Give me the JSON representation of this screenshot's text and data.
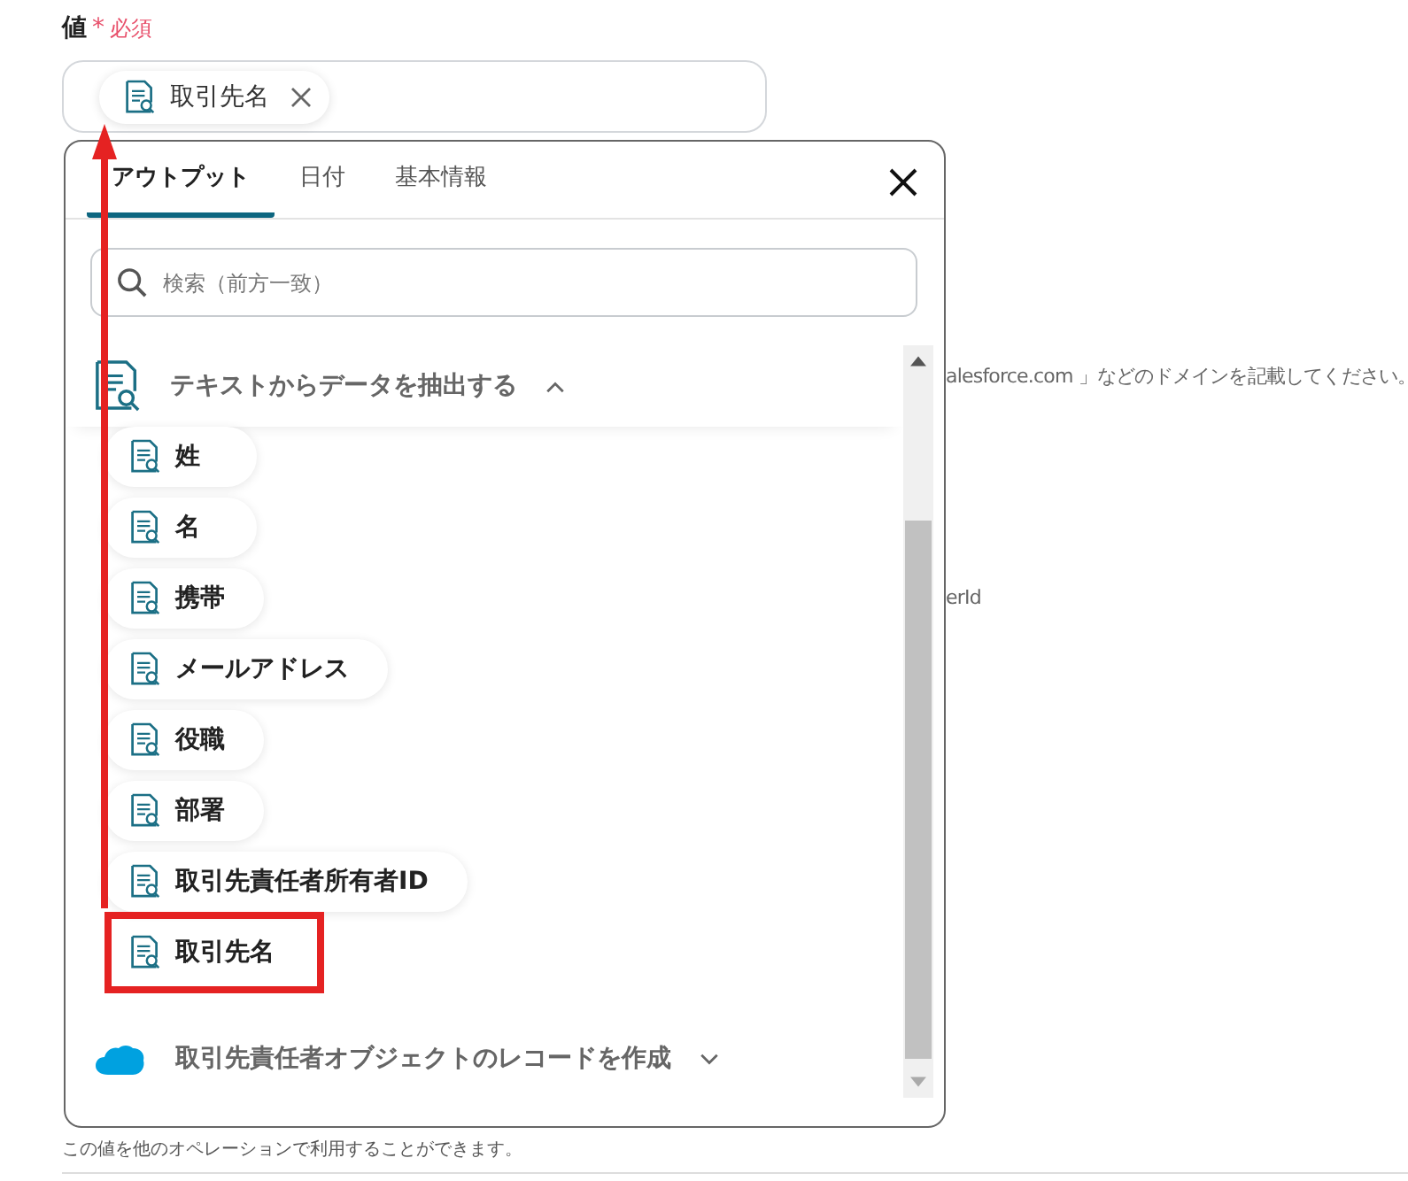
{
  "field": {
    "label": "値",
    "required_mark": "*",
    "required_text": "必須",
    "chips": [
      {
        "label": "取引先名"
      }
    ]
  },
  "popup": {
    "tabs": [
      {
        "label": "アウトプット",
        "selected": true
      },
      {
        "label": "日付",
        "selected": false
      },
      {
        "label": "基本情報",
        "selected": false
      }
    ],
    "search": {
      "placeholder": "検索（前方一致）"
    },
    "groups": [
      {
        "kind": "text-extract",
        "title": "テキストからデータを抽出する",
        "expanded": true,
        "items": [
          {
            "label": "姓",
            "highlighted": false
          },
          {
            "label": "名",
            "highlighted": false
          },
          {
            "label": "携帯",
            "highlighted": false
          },
          {
            "label": "メールアドレス",
            "highlighted": false
          },
          {
            "label": "役職",
            "highlighted": false
          },
          {
            "label": "部署",
            "highlighted": false
          },
          {
            "label": "取引先責任者所有者ID",
            "highlighted": false
          },
          {
            "label": "取引先名",
            "highlighted": true
          }
        ]
      },
      {
        "kind": "salesforce",
        "title": "取引先責任者オブジェクトのレコードを作成",
        "expanded": false
      }
    ]
  },
  "background": {
    "hints": [
      "alesforce.com 」などのドメインを記載してください。",
      "erId"
    ],
    "help_text": "この値を他のオペレーションで利用することができます。"
  }
}
